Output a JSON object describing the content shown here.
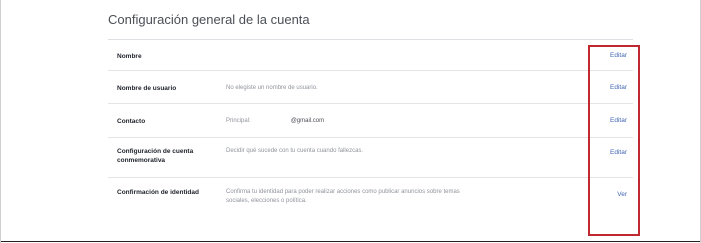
{
  "section": {
    "title": "Configuración general de la cuenta"
  },
  "rows": [
    {
      "label": "Nombre",
      "value": "",
      "action": "Editar"
    },
    {
      "label": "Nombre de usuario",
      "value": "No elegiste un nombre de usuario.",
      "action": "Editar"
    },
    {
      "label": "Contacto",
      "value_prefix": "Principal:",
      "value_email": "@gmail.com",
      "action": "Editar"
    },
    {
      "label": "Configuración de cuenta conmemorativa",
      "value": "Decidir qué sucede con tu cuenta cuando fallezcas.",
      "action": "Editar"
    },
    {
      "label": "Confirmación de identidad",
      "value": "Confirma tu identidad para poder realizar acciones como publicar anuncios sobre temas sociales, elecciones o política.",
      "action": "Ver"
    }
  ],
  "colors": {
    "highlight": "#c0282f",
    "link": "#4267b2"
  }
}
